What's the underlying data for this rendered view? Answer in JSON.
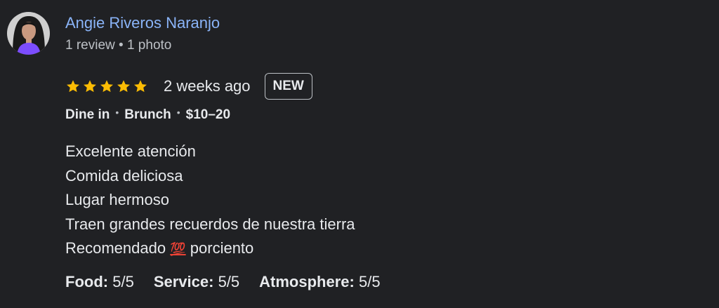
{
  "reviewer": {
    "name": "Angie Riveros Naranjo",
    "meta": "1 review • 1 photo"
  },
  "rating": {
    "stars": 5,
    "star_color": "#fbbc04",
    "time": "2 weeks ago",
    "badge": "NEW"
  },
  "tags": {
    "service": "Dine in",
    "meal": "Brunch",
    "price": "$10–20"
  },
  "review": {
    "line1": "Excelente atención",
    "line2": "Comida deliciosa",
    "line3": "Lugar hermoso",
    "line4": "Traen grandes recuerdos de nuestra tierra",
    "line5_before": "Recomendado",
    "line5_emoji": "💯",
    "line5_after": "porciento"
  },
  "scores": {
    "food_label": "Food:",
    "food_value": "5/5",
    "service_label": "Service:",
    "service_value": "5/5",
    "atmosphere_label": "Atmosphere:",
    "atmosphere_value": "5/5"
  }
}
